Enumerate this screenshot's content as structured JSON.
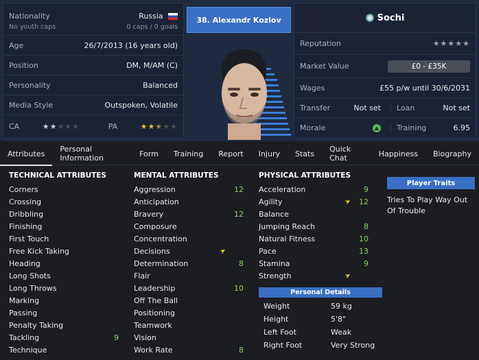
{
  "player": {
    "name": "38. Alexandr Kozlov",
    "club": "Sochi"
  },
  "left_info": {
    "nationality_label": "Nationality",
    "nationality": "Russia",
    "youth_caps": "No youth caps",
    "caps": "0 caps / 0 goals",
    "age_label": "Age",
    "age": "26/7/2013 (16 years old)",
    "position_label": "Position",
    "position": "DM, M/AM (C)",
    "personality_label": "Personality",
    "personality": "Balanced",
    "media_label": "Media Style",
    "media": "Outspoken, Volatile",
    "ca_label": "CA",
    "ca_stars": 2,
    "pa_label": "PA",
    "pa_stars": 2.5
  },
  "right_info": {
    "reputation_label": "Reputation",
    "reputation_stars": 0,
    "market_label": "Market Value",
    "market": "£0 - £35K",
    "wages_label": "Wages",
    "wages": "£55 p/w until 30/6/2031",
    "transfer_label": "Transfer",
    "transfer": "Not set",
    "loan_label": "Loan",
    "loan": "Not set",
    "morale_label": "Morale",
    "morale_icon": "morale-icon",
    "training_label": "Training",
    "training": "6.95"
  },
  "tabs": [
    "Attributes",
    "Personal Information",
    "Form",
    "Training",
    "Report",
    "Injury",
    "Stats",
    "Quick Chat",
    "Happiness",
    "Biography"
  ],
  "technical": {
    "title": "TECHNICAL ATTRIBUTES",
    "items": [
      {
        "name": "Corners",
        "value": ""
      },
      {
        "name": "Crossing",
        "value": ""
      },
      {
        "name": "Dribbling",
        "value": ""
      },
      {
        "name": "Finishing",
        "value": ""
      },
      {
        "name": "First Touch",
        "value": ""
      },
      {
        "name": "Free Kick Taking",
        "value": ""
      },
      {
        "name": "Heading",
        "value": ""
      },
      {
        "name": "Long Shots",
        "value": ""
      },
      {
        "name": "Long Throws",
        "value": ""
      },
      {
        "name": "Marking",
        "value": ""
      },
      {
        "name": "Passing",
        "value": ""
      },
      {
        "name": "Penalty Taking",
        "value": ""
      },
      {
        "name": "Tackling",
        "value": "9"
      },
      {
        "name": "Technique",
        "value": ""
      }
    ]
  },
  "mental": {
    "title": "MENTAL ATTRIBUTES",
    "items": [
      {
        "name": "Aggression",
        "value": "12"
      },
      {
        "name": "Anticipation",
        "value": ""
      },
      {
        "name": "Bravery",
        "value": "12"
      },
      {
        "name": "Composure",
        "value": ""
      },
      {
        "name": "Concentration",
        "value": ""
      },
      {
        "name": "Decisions",
        "value": "",
        "arrow": true
      },
      {
        "name": "Determination",
        "value": "8"
      },
      {
        "name": "Flair",
        "value": ""
      },
      {
        "name": "Leadership",
        "value": "10"
      },
      {
        "name": "Off The Ball",
        "value": ""
      },
      {
        "name": "Positioning",
        "value": ""
      },
      {
        "name": "Teamwork",
        "value": ""
      },
      {
        "name": "Vision",
        "value": ""
      },
      {
        "name": "Work Rate",
        "value": "8"
      }
    ]
  },
  "physical": {
    "title": "PHYSICAL ATTRIBUTES",
    "items": [
      {
        "name": "Acceleration",
        "value": "9"
      },
      {
        "name": "Agility",
        "value": "12",
        "arrow": true
      },
      {
        "name": "Balance",
        "value": ""
      },
      {
        "name": "Jumping Reach",
        "value": "8"
      },
      {
        "name": "Natural Fitness",
        "value": "10"
      },
      {
        "name": "Pace",
        "value": "13"
      },
      {
        "name": "Stamina",
        "value": "9"
      },
      {
        "name": "Strength",
        "value": "",
        "arrow": true
      }
    ]
  },
  "traits": {
    "title": "Player Traits",
    "text": "Tries To Play Way Out Of Trouble"
  },
  "personal": {
    "title": "Personal Details",
    "items": [
      {
        "k": "Weight",
        "v": "59 kg"
      },
      {
        "k": "Height",
        "v": "5'8\""
      },
      {
        "k": "Left Foot",
        "v": "Weak"
      },
      {
        "k": "Right Foot",
        "v": "Very Strong"
      }
    ]
  }
}
